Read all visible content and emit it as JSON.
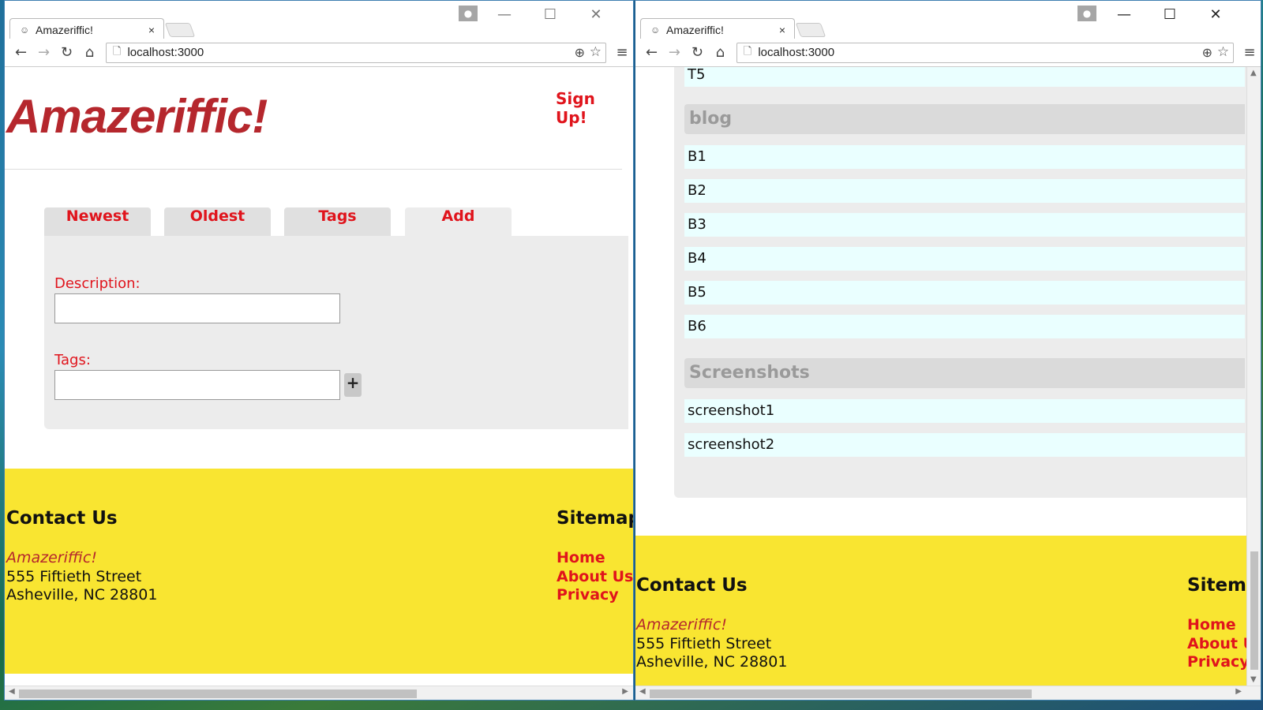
{
  "windows": {
    "left": {
      "tab_title": "Amazeriffic!",
      "tab_close": "×",
      "url": "localhost:3000",
      "win_controls": {
        "minimize": "—",
        "maximize": "☐",
        "close": "✕"
      }
    },
    "right": {
      "tab_title": "Amazeriffic!",
      "tab_close": "×",
      "url": "localhost:3000",
      "win_controls": {
        "minimize": "—",
        "maximize": "☐",
        "close": "✕"
      }
    }
  },
  "nav_icons": {
    "back": "←",
    "forward": "→",
    "reload": "↻",
    "home": "⌂",
    "page": "🗋",
    "zoom": "⊕",
    "star": "☆",
    "menu": "≡",
    "favicon": "☺"
  },
  "app": {
    "logo": "Amazeriffic!",
    "signup": "Sign Up!",
    "tabs": [
      "Newest",
      "Oldest",
      "Tags",
      "Add"
    ],
    "form": {
      "description_label": "Description:",
      "tags_label": "Tags:",
      "add_tag_button": "+"
    }
  },
  "tag_list": {
    "top_item": "T5",
    "groups": [
      {
        "name": "blog",
        "items": [
          "B1",
          "B2",
          "B3",
          "B4",
          "B5",
          "B6"
        ]
      },
      {
        "name": "Screenshots",
        "items": [
          "screenshot1",
          "screenshot2"
        ]
      }
    ]
  },
  "footer": {
    "contact_heading": "Contact Us",
    "company": "Amazeriffic!",
    "street": "555 Fiftieth Street",
    "city": "Asheville, NC 28801",
    "sitemap_heading_left": "Sitemap",
    "sitemap_heading_right": "Sitem",
    "links_left": [
      "Home",
      "About Us",
      "Privacy"
    ],
    "links_right": [
      "Home",
      "About U",
      "Privacy"
    ]
  },
  "colors": {
    "accent": "#e0141c",
    "logo": "#b5272d",
    "footer_bg": "#f9e531",
    "panel_bg": "#ececec",
    "item_bg": "#eaffff"
  }
}
